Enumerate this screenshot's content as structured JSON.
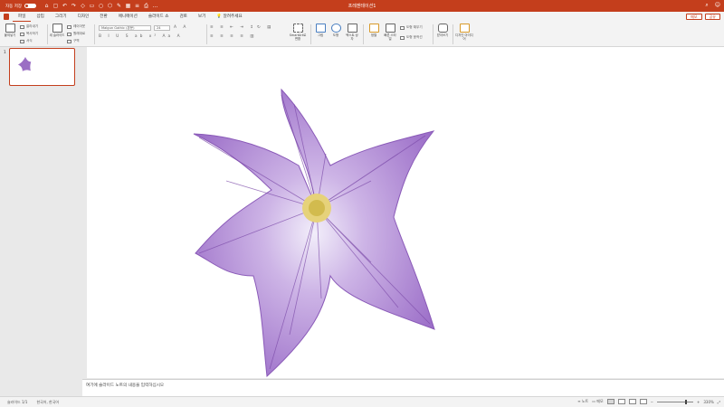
{
  "titlebar": {
    "autosave_label": "자동 저장",
    "toggle_state": "끔",
    "doc_title": "프레젠테이션1",
    "accent": "#c43e1c"
  },
  "menubar": {
    "items": [
      "파일",
      "삽입",
      "그리기",
      "디자인",
      "전환",
      "애니메이션",
      "슬라이드 쇼",
      "검토",
      "보기",
      "알려주세요"
    ],
    "comment_label": "메모",
    "share_label": "공유"
  },
  "ribbon": {
    "paste": "붙여넣기",
    "cut": "잘라내기",
    "copy": "복사하기",
    "format": "서식",
    "new_slide": "새 슬라이드",
    "layout": "레이아웃",
    "reset": "원래대로",
    "section": "구역",
    "font_name": "Malgun Gothic (본문)",
    "font_size": "24",
    "smartart": "SmartArt로 변환",
    "picture": "그림",
    "shapes": "도형",
    "textbox": "텍스트 상자",
    "arrange": "정렬",
    "quick_styles": "빠른 스타일",
    "shape_fill": "도형 채우기",
    "shape_outline": "도형 윤곽선",
    "dictate": "받아쓰기",
    "designer": "디자인 아이디어"
  },
  "sidebar": {
    "slide_number": "1"
  },
  "notes": {
    "placeholder": "여기에 슬라이드 노트의 내용을 입력하십시오"
  },
  "status": {
    "slide_info": "슬라이드 1/1",
    "language": "한국어, 한국어",
    "notes_btn": "노트",
    "comments_btn": "메모",
    "zoom": "330%"
  }
}
